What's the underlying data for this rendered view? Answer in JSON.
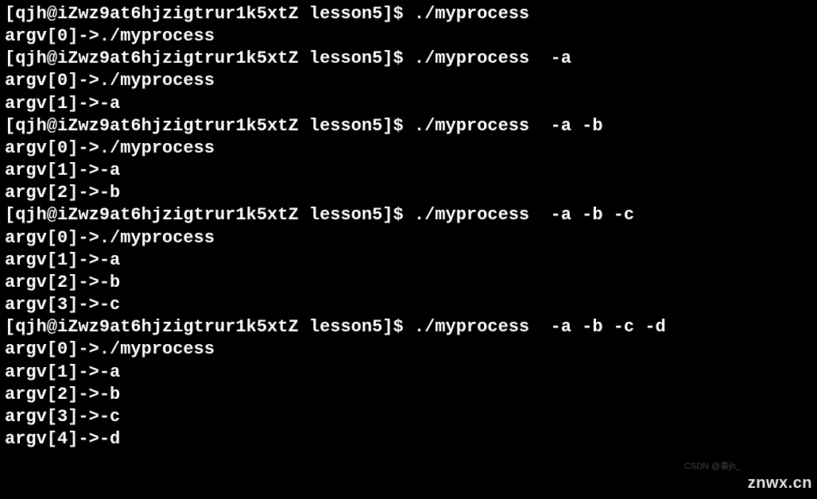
{
  "terminal": {
    "lines": [
      "[qjh@iZwz9at6hjzigtrur1k5xtZ lesson5]$ ./myprocess",
      "argv[0]->./myprocess",
      "[qjh@iZwz9at6hjzigtrur1k5xtZ lesson5]$ ./myprocess  -a",
      "argv[0]->./myprocess",
      "argv[1]->-a",
      "[qjh@iZwz9at6hjzigtrur1k5xtZ lesson5]$ ./myprocess  -a -b",
      "argv[0]->./myprocess",
      "argv[1]->-a",
      "argv[2]->-b",
      "[qjh@iZwz9at6hjzigtrur1k5xtZ lesson5]$ ./myprocess  -a -b -c",
      "argv[0]->./myprocess",
      "argv[1]->-a",
      "argv[2]->-b",
      "argv[3]->-c",
      "[qjh@iZwz9at6hjzigtrur1k5xtZ lesson5]$ ./myprocess  -a -b -c -d",
      "argv[0]->./myprocess",
      "argv[1]->-a",
      "argv[2]->-b",
      "argv[3]->-c",
      "argv[4]->-d"
    ]
  },
  "watermark": {
    "csdn": "CSDN @秦jh_",
    "znwx": "znwx.cn"
  }
}
